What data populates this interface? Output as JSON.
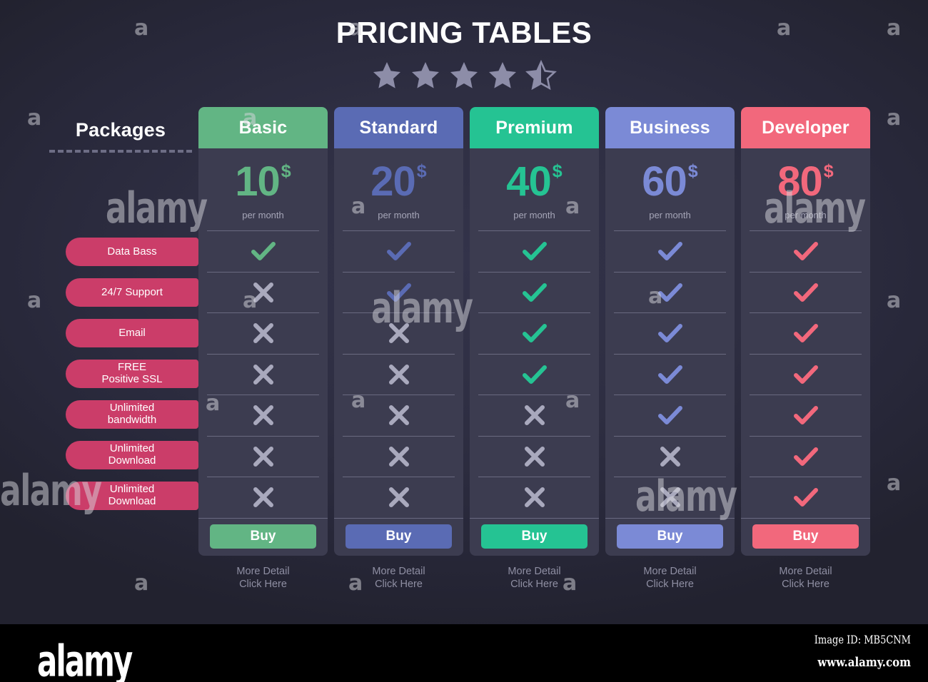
{
  "page": {
    "title": "PRICING TABLES",
    "background_color": "#2e2e42",
    "rating": {
      "value": 4.5,
      "max": 5,
      "star_color": "#8d8da8"
    }
  },
  "packages": {
    "label": "Packages",
    "features": [
      "Data Bass",
      "24/7 Support",
      "Email",
      "FREE Positive SSL",
      "Unlimited bandwidth",
      "Unlimited Download",
      "Unlimited Download"
    ],
    "pill_color": "#cb3d69"
  },
  "common": {
    "currency_symbol": "$",
    "period_label": "per month",
    "buy_label": "Buy",
    "more_detail_line1": "More Detail",
    "more_detail_line2": "Click Here",
    "check_icon": "check-icon",
    "cross_icon": "cross-icon",
    "cross_color": "#a9a9bd"
  },
  "plans": [
    {
      "name": "Basic",
      "price": "10",
      "currency": "$",
      "period": "per month",
      "color": "#62b584",
      "buy_label": "Buy",
      "features": [
        true,
        false,
        false,
        false,
        false,
        false,
        false
      ]
    },
    {
      "name": "Standard",
      "price": "20",
      "currency": "$",
      "period": "per month",
      "color": "#5a6bb4",
      "buy_label": "Buy",
      "features": [
        true,
        true,
        false,
        false,
        false,
        false,
        false
      ]
    },
    {
      "name": "Premium",
      "price": "40",
      "currency": "$",
      "period": "per month",
      "color": "#25c393",
      "buy_label": "Buy",
      "features": [
        true,
        true,
        true,
        true,
        false,
        false,
        false
      ]
    },
    {
      "name": "Business",
      "price": "60",
      "currency": "$",
      "period": "per month",
      "color": "#7b8ad6",
      "buy_label": "Buy",
      "features": [
        true,
        true,
        true,
        true,
        true,
        false,
        false
      ]
    },
    {
      "name": "Developer",
      "price": "80",
      "currency": "$",
      "period": "per month",
      "color": "#f2687c",
      "buy_label": "Buy",
      "features": [
        true,
        true,
        true,
        true,
        true,
        true,
        true
      ]
    }
  ],
  "watermark": {
    "letter": "a",
    "word": "alamy"
  },
  "footer": {
    "logo": "alamy",
    "image_id": "Image ID: MB5CNM",
    "url": "www.alamy.com"
  }
}
